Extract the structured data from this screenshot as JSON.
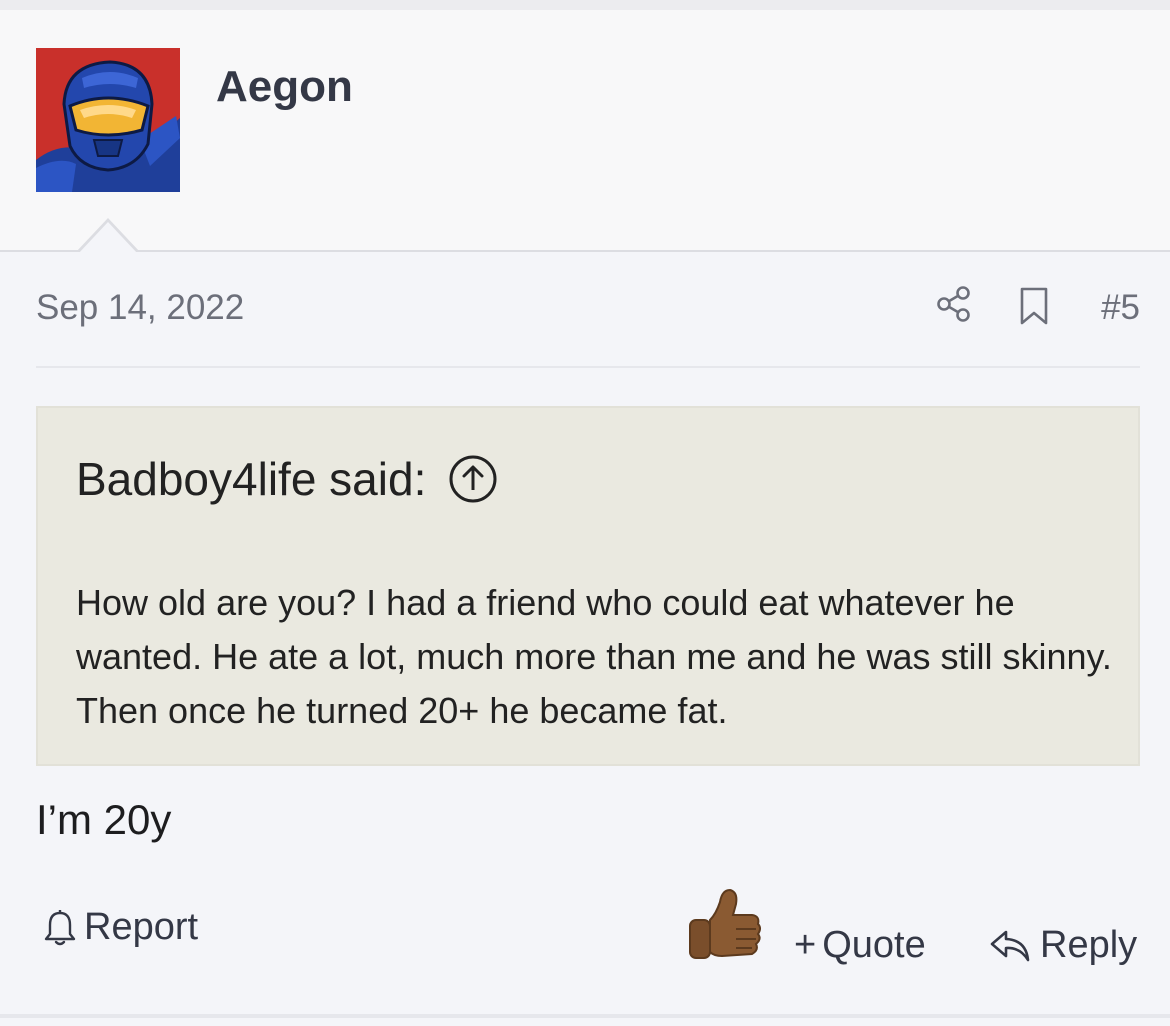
{
  "post": {
    "author": "Aegon",
    "date": "Sep 14, 2022",
    "number": "#5",
    "quote": {
      "attribution": "Badboy4life said:",
      "text": "How old are you? I had a friend who could eat whatever he wanted. He ate a lot, much more than me and he was still skinny. Then once he turned 20+ he became fat."
    },
    "body": "I’m 20y"
  },
  "actions": {
    "report_label": "Report",
    "quote_label": "Quote",
    "quote_prefix": "+",
    "reply_label": "Reply"
  },
  "icons": {
    "share": "share-icon",
    "bookmark": "bookmark-icon",
    "quote_jump": "arrow-up-circle-icon",
    "bell": "bell-icon",
    "reaction": "thumbs-up-emoji",
    "reply": "reply-arrow-icon"
  },
  "colors": {
    "page_background": "#f4f5f9",
    "quote_background": "#eae9e0",
    "muted_text": "#6c6f7a",
    "action_text": "#343846",
    "avatar_background": "#c9302b"
  }
}
